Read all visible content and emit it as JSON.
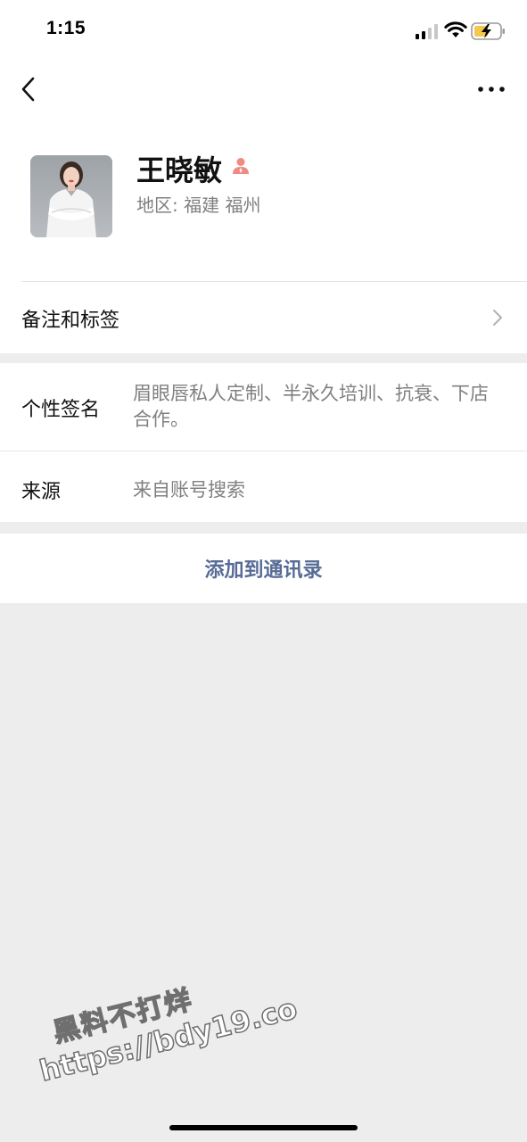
{
  "status_bar": {
    "time": "1:15"
  },
  "profile": {
    "name": "王晓敏",
    "region_label": "地区:",
    "region_value": "福建 福州"
  },
  "remarks": {
    "label": "备注和标签"
  },
  "info": {
    "signature_label": "个性签名",
    "signature_value": "眉眼唇私人定制、半永久培训、抗衰、下店合作。",
    "source_label": "来源",
    "source_value": "来自账号搜索"
  },
  "actions": {
    "add_contact_label": "添加到通讯录"
  },
  "watermark": {
    "line1": "黑料不打烊",
    "line2": "https://bdy19.co"
  },
  "colors": {
    "link": "#576b95",
    "secondary_text": "#808080",
    "background": "#ededed",
    "contact_icon": "#f08a82"
  }
}
